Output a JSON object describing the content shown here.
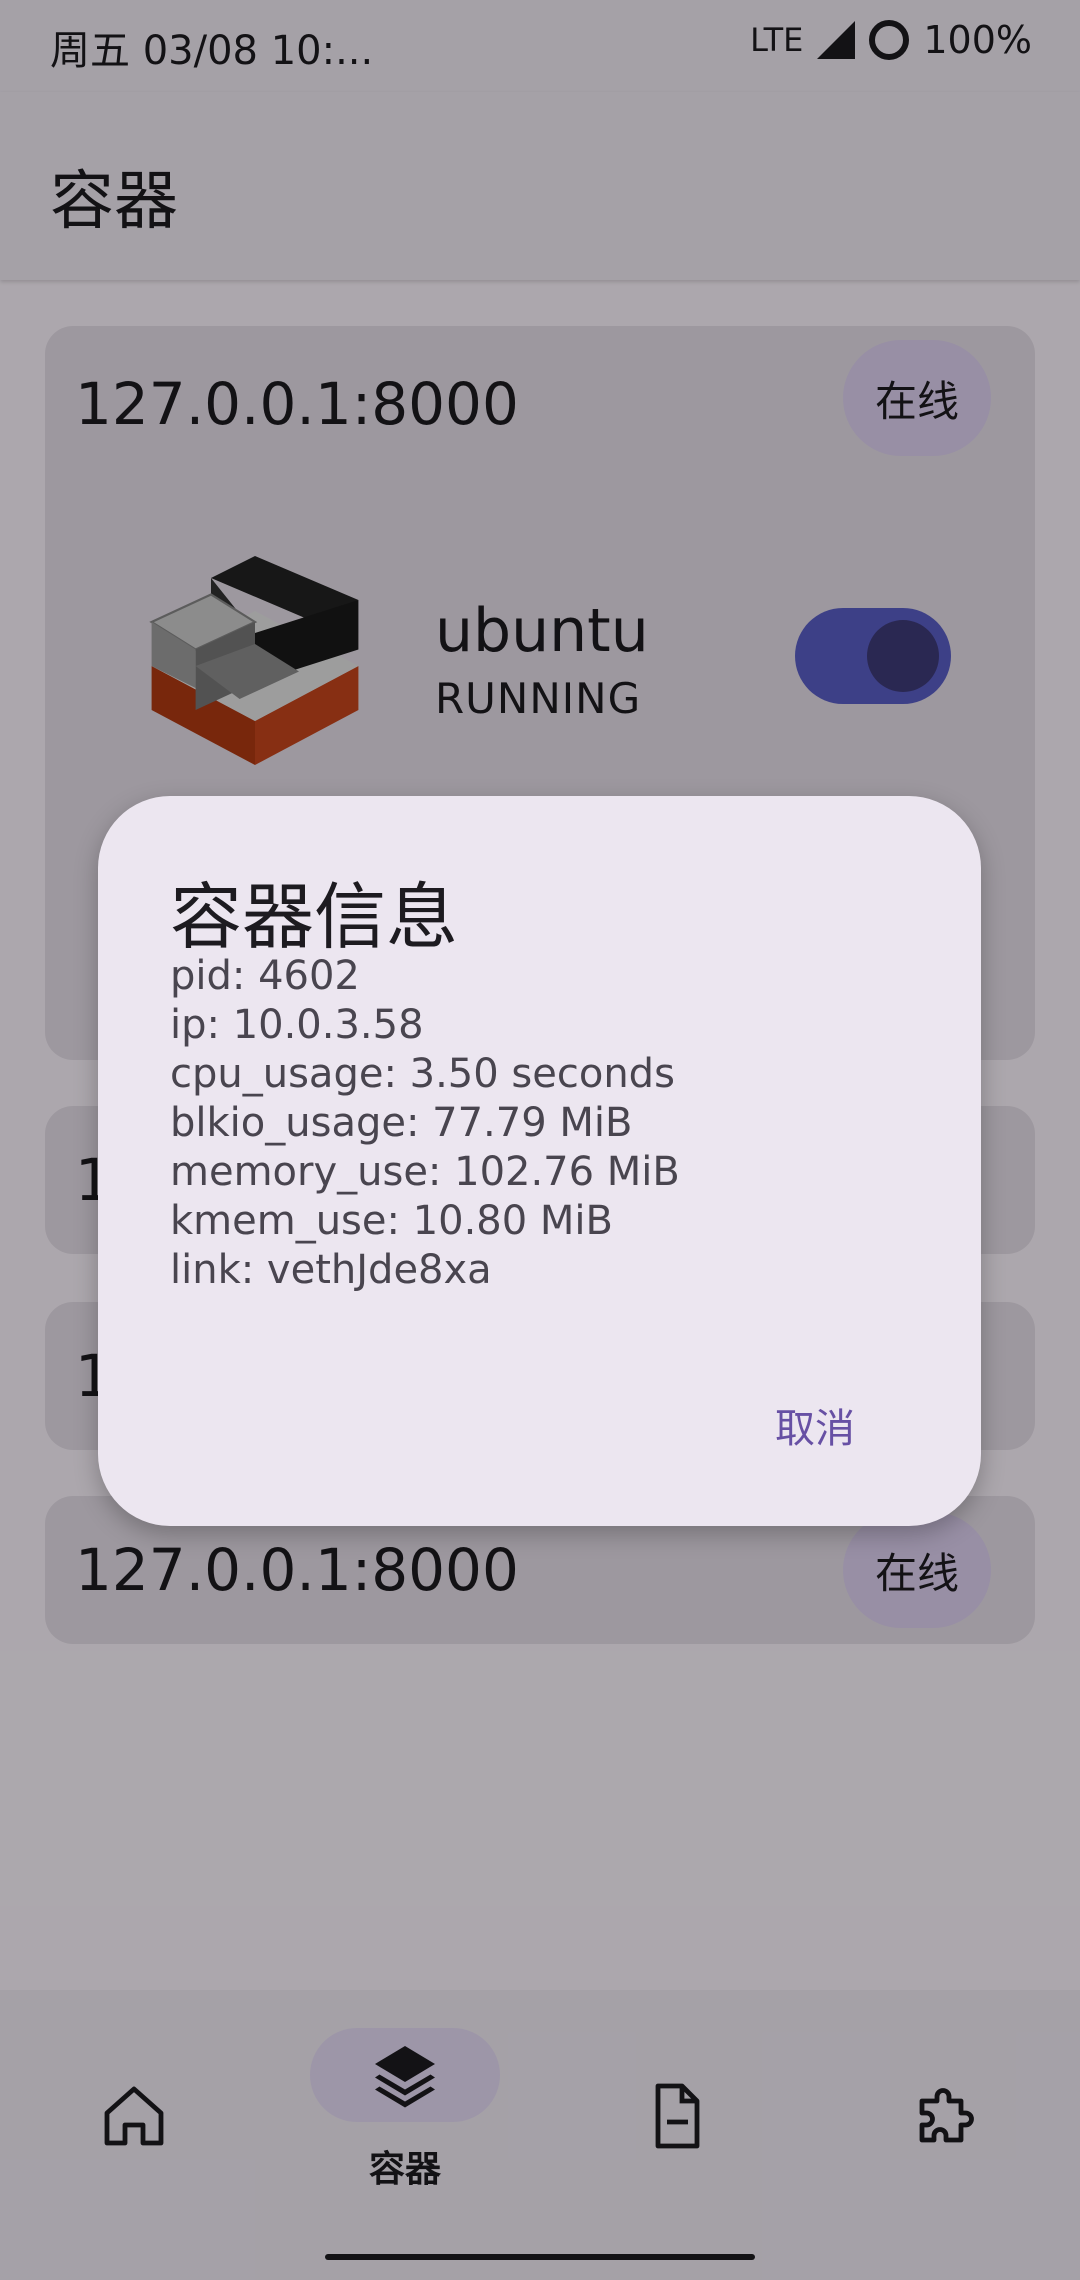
{
  "status_bar": {
    "time": "周五 03/08 10:...",
    "network": "LTE",
    "battery": "100%"
  },
  "app_bar": {
    "title": "容器"
  },
  "cards": [
    {
      "host": "127.0.0.1:8000",
      "status_chip": "在线",
      "container": {
        "name": "ubuntu",
        "state": "RUNNING",
        "enabled": true
      }
    },
    {
      "host_visible": "1"
    },
    {
      "host_visible": "1"
    },
    {
      "host": "127.0.0.1:8000",
      "status_chip": "在线"
    }
  ],
  "dialog": {
    "title": "容器信息",
    "lines": [
      "pid: 4602",
      "ip: 10.0.3.58",
      "cpu_usage: 3.50 seconds",
      "blkio_usage: 77.79 MiB",
      "memory_use: 102.76 MiB",
      "kmem_use: 10.80 MiB",
      "link: vethJde8xa"
    ],
    "cancel_label": "取消"
  },
  "bottom_nav": {
    "items": [
      {
        "icon": "home-icon"
      },
      {
        "icon": "layers-icon",
        "label": "容器",
        "selected": true
      },
      {
        "icon": "document-icon"
      },
      {
        "icon": "puzzle-icon"
      }
    ]
  },
  "colors": {
    "accent": "#6750a4",
    "toggle": "#5b5fc7",
    "surface": "#ece6f0"
  }
}
